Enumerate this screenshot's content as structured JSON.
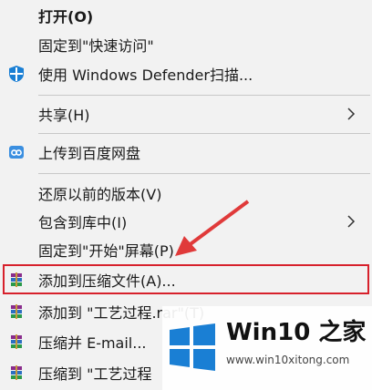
{
  "menu": {
    "items": [
      {
        "label": "打开(O)",
        "icon": "none"
      },
      {
        "label": "固定到\"快速访问\"",
        "icon": "none"
      },
      {
        "label": "使用 Windows Defender扫描...",
        "icon": "defender-shield-icon"
      },
      {
        "label": "共享(H)",
        "icon": "none",
        "submenu": true
      },
      {
        "label": "上传到百度网盘",
        "icon": "baidu-cloud-icon"
      },
      {
        "label": "还原以前的版本(V)",
        "icon": "none"
      },
      {
        "label": "包含到库中(I)",
        "icon": "none",
        "submenu": true
      },
      {
        "label": "固定到\"开始\"屏幕(P)",
        "icon": "none"
      },
      {
        "label": "添加到压缩文件(A)...",
        "icon": "winrar-icon",
        "highlighted": true
      },
      {
        "label": "添加到 \"工艺过程.rar\"(T)",
        "icon": "winrar-icon"
      },
      {
        "label": "压缩并 E-mail...",
        "icon": "winrar-icon"
      },
      {
        "label": "压缩到 \"工艺过程",
        "icon": "winrar-icon"
      }
    ]
  },
  "watermark": {
    "title": "Win10 之家",
    "url": "www.win10xitong.com"
  },
  "colors": {
    "highlight_border": "#d7212c",
    "arrow": "#e03a3a",
    "accent_blue": "#1a7fd4"
  }
}
